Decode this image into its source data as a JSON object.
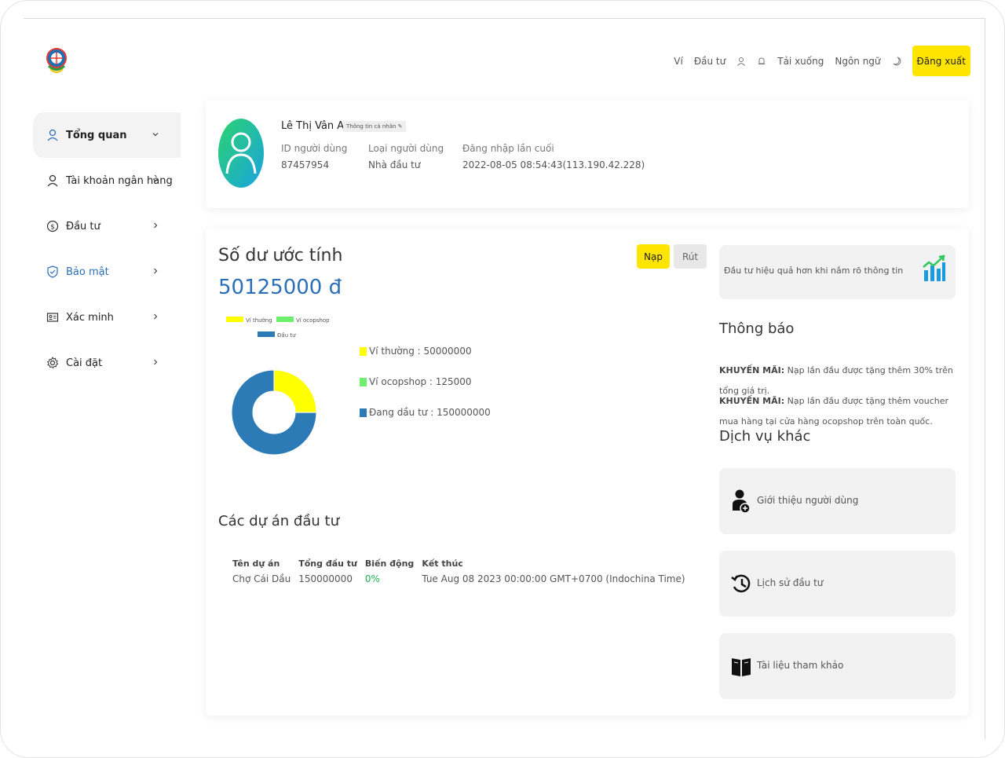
{
  "topnav": {
    "items": [
      "Ví",
      "Đầu tư",
      "Tải xuống",
      "Ngôn ngữ"
    ],
    "logout": "Đăng xuất"
  },
  "sidebar": {
    "items": [
      {
        "label": "Tổng quan",
        "icon": "user-icon",
        "chevron": "down"
      },
      {
        "label": "Tài khoản ngân hàng",
        "icon": "user-icon",
        "chevron": "down"
      },
      {
        "label": "Đầu tư",
        "icon": "money-icon",
        "chevron": "right"
      },
      {
        "label": "Bảo mật",
        "icon": "shield-icon",
        "chevron": "right"
      },
      {
        "label": "Xác minh",
        "icon": "id-card-icon",
        "chevron": "right"
      },
      {
        "label": "Cài đặt",
        "icon": "gear-icon",
        "chevron": "right"
      }
    ]
  },
  "profile": {
    "name": "Lê Thị Vân Anh",
    "info_badge": "Thông tin cá nhân",
    "id_label": "ID người dùng",
    "id_value": "87457954",
    "type_label": "Loại người dùng",
    "type_value": "Nhà đầu tư",
    "login_label": "Đăng nhập lần cuối",
    "login_value": "2022-08-05 08:54:43(113.190.42.228)"
  },
  "balance": {
    "title": "Số dư ước tính",
    "value": "50125000 đ",
    "deposit_button": "Nạp",
    "withdraw_button": "Rút"
  },
  "chart_data": {
    "type": "pie",
    "categories": [
      "Ví thường",
      "Ví ocopshop",
      "Đầu tư"
    ],
    "values": [
      50000000,
      125000,
      150000000
    ],
    "colors": [
      "#ffff00",
      "#6ef06e",
      "#2c7bb6"
    ],
    "legend_placement": "top"
  },
  "legend_list": [
    {
      "text": "Ví thường : 50000000",
      "color": "#ffff00"
    },
    {
      "text": "Ví ocopshop : 125000",
      "color": "#6ef06e"
    },
    {
      "text": "Đang dầu tư : 150000000",
      "color": "#2c7bb6"
    }
  ],
  "projects": {
    "title": "Các dự án đầu tư",
    "headers": [
      "Tên dự án",
      "Tổng đầu tư",
      "Biến động",
      "Kết thúc"
    ],
    "rows": [
      [
        "Chợ Cái Dầu",
        "150000000",
        "0%",
        "Tue Aug 08 2023 00:00:00 GMT+0700 (Indochina Time)"
      ]
    ],
    "change_color": "#22b14c"
  },
  "tip": {
    "text": "Đầu tư hiệu quả hơn khi nắm rõ thông tin"
  },
  "notice": {
    "title": "Thông báo",
    "items": [
      {
        "prefix": "KHUYẾN MÃI:",
        "text": " Nạp lần đầu được tặng thêm 30% trên tổng giá trị."
      },
      {
        "prefix": "KHUYẾN MÃI:",
        "text": " Nạp lần đầu được tặng thêm voucher mua hàng tại cửa hàng ocopshop trên toàn quốc."
      }
    ]
  },
  "services": {
    "title": "Dịch vụ khác",
    "items": [
      {
        "label": "Giới thiệu người dùng",
        "icon": "user-add-icon"
      },
      {
        "label": "Lịch sử đầu tư",
        "icon": "history-icon"
      },
      {
        "label": "Tài liệu tham khảo",
        "icon": "book-icon"
      }
    ]
  },
  "colors": {
    "accent_yellow": "#ffe500",
    "brand_blue": "#2a6fb8"
  }
}
